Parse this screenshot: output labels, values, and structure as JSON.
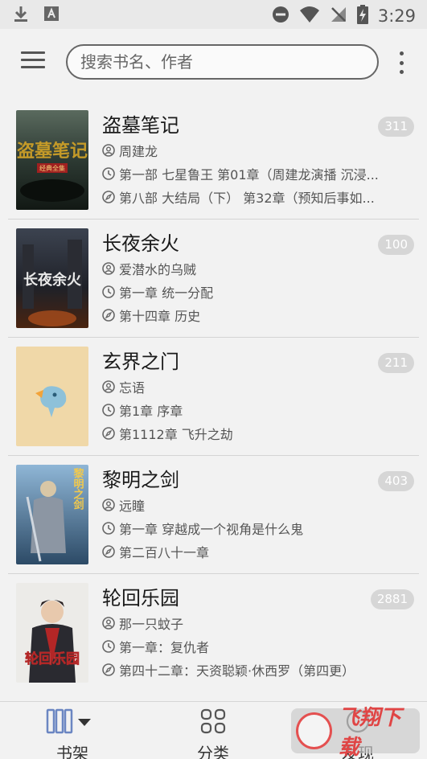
{
  "status_bar": {
    "time": "3:29"
  },
  "search": {
    "placeholder": "搜索书名、作者"
  },
  "books": [
    {
      "title": "盗墓笔记",
      "author": "周建龙",
      "last_read": "第一部 七星鲁王 第01章（周建龙演播 沉浸...",
      "latest": "第八部 大结局（下） 第32章（预知后事如...",
      "count": "311",
      "cover_text": "盗墓笔记",
      "cover_tag": "经典全集"
    },
    {
      "title": "长夜余火",
      "author": "爱潜水的乌贼",
      "last_read": "第一章 统一分配",
      "latest": "第十四章 历史",
      "count": "100",
      "cover_text": "长夜余火"
    },
    {
      "title": "玄界之门",
      "author": "忘语",
      "last_read": "第1章 序章",
      "latest": "第1112章 飞升之劫",
      "count": "211"
    },
    {
      "title": "黎明之剑",
      "author": "远瞳",
      "last_read": "第一章 穿越成一个视角是什么鬼",
      "latest": "第二百八十一章",
      "count": "403",
      "cover_text": "黎明之剑"
    },
    {
      "title": "轮回乐园",
      "author": "那一只蚊子",
      "last_read": "第一章：复仇者",
      "latest": "第四十二章：天资聪颖·休西罗（第四更）",
      "count": "2881",
      "cover_text": "轮回乐园"
    }
  ],
  "nav": {
    "bookshelf": "书架",
    "category": "分类",
    "discover": "发现"
  },
  "watermark": {
    "text": "飞翔下载"
  }
}
